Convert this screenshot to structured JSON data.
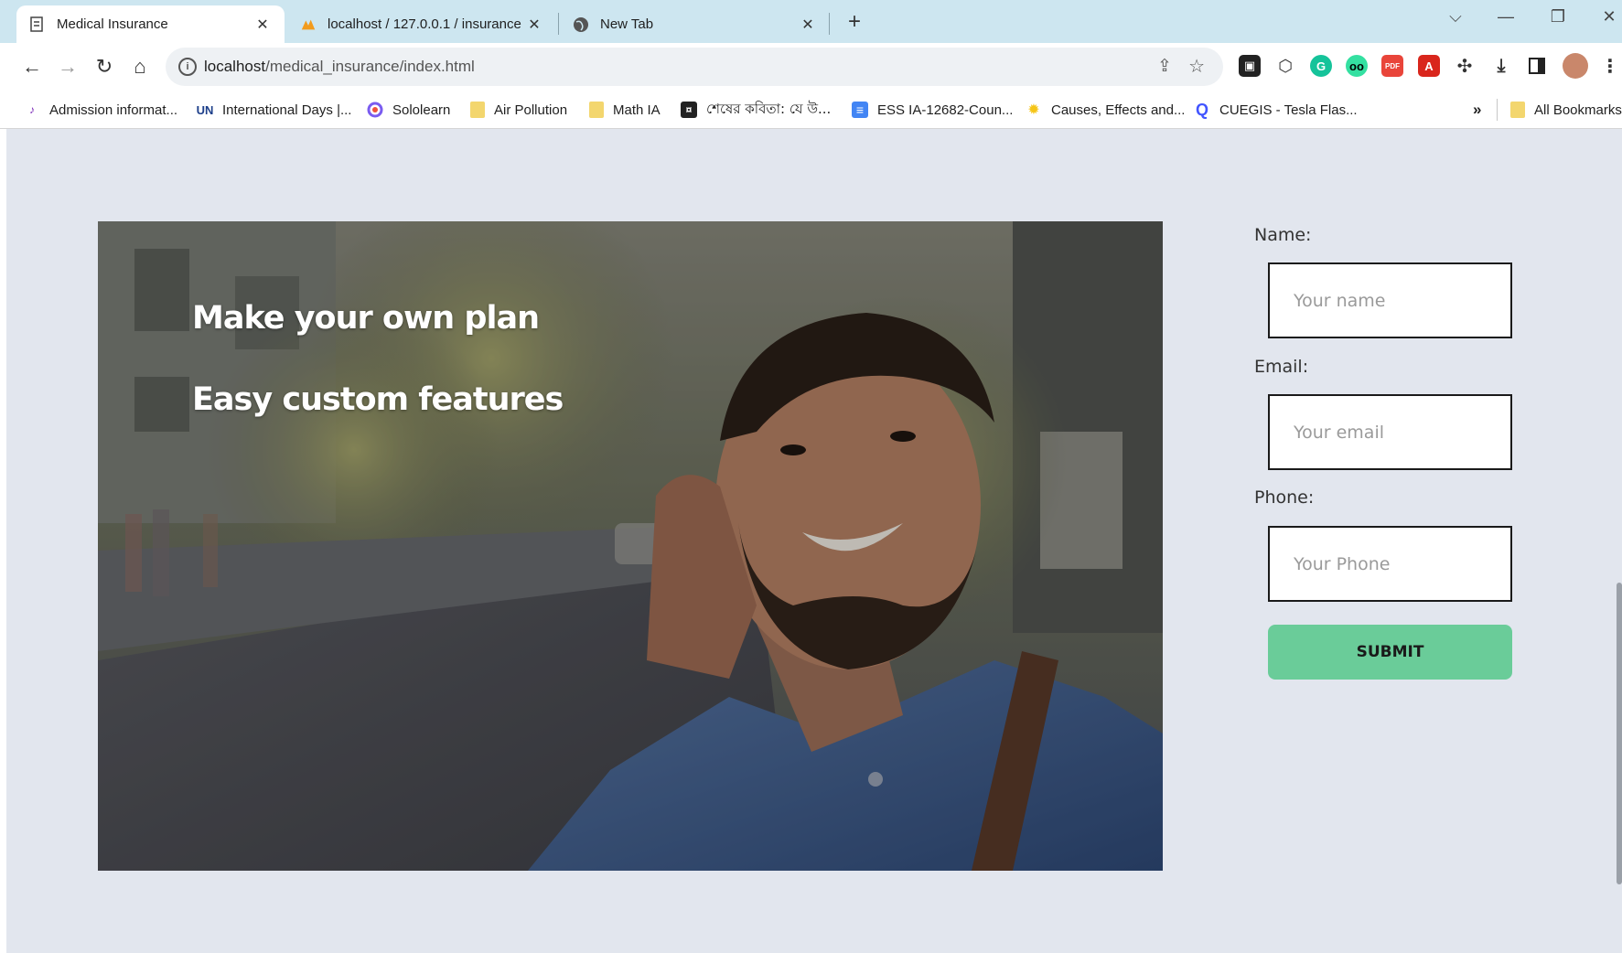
{
  "tabs": [
    {
      "title": "Medical Insurance",
      "close": "✕"
    },
    {
      "title": "localhost / 127.0.0.1 / insurance",
      "close": "✕"
    },
    {
      "title": "New Tab",
      "close": "✕"
    }
  ],
  "new_tab": "+",
  "window_controls": {
    "dropdown": "⌵",
    "minimize": "—",
    "restore": "❐",
    "close": "✕"
  },
  "toolbar": {
    "back": "←",
    "forward": "→",
    "reload": "↻",
    "home": "⌂",
    "url_host": "localhost",
    "url_path": "/medical_insurance/index.html",
    "share": "⇪",
    "bookmark_star": "☆"
  },
  "extensions": [
    "tab-manager-icon",
    "cube-icon",
    "grammarly-icon",
    "tripadvisor-icon",
    "pdf-extension-icon",
    "acrobat-icon",
    "puzzle-icon",
    "download-icon",
    "side-panel-icon",
    "profile-avatar",
    "menu-icon"
  ],
  "bookmarks": [
    {
      "label": "Admission informat...",
      "icon": "bird-logo-icon"
    },
    {
      "label": "International Days |...",
      "icon": "un-logo-icon",
      "mark": "UN"
    },
    {
      "label": "Sololearn",
      "icon": "sololearn-icon"
    },
    {
      "label": "Air Pollution",
      "icon": "folder-icon"
    },
    {
      "label": "Math IA",
      "icon": "folder-icon"
    },
    {
      "label": "শেষের কবিতা: যে উ...",
      "icon": "book-icon"
    },
    {
      "label": "ESS IA-12682-Coun...",
      "icon": "docs-icon"
    },
    {
      "label": "Causes, Effects and...",
      "icon": "sun-icon"
    },
    {
      "label": "CUEGIS - Tesla Flas...",
      "icon": "quizlet-icon",
      "mark": "Q"
    }
  ],
  "bookmarks_more": "»",
  "all_bookmarks": "All Bookmarks",
  "hero": {
    "line1": "Make your own plan",
    "line2": "Easy custom features"
  },
  "form": {
    "name_label": "Name:",
    "name_placeholder": "Your name",
    "email_label": "Email:",
    "email_placeholder": "Your email",
    "phone_label": "Phone:",
    "phone_placeholder": "Your Phone",
    "submit_label": "SUBMIT"
  },
  "colors": {
    "tabstrip": "#cde6f0",
    "page_bg": "#e2e6ee",
    "submit_bg": "#6acc99"
  }
}
